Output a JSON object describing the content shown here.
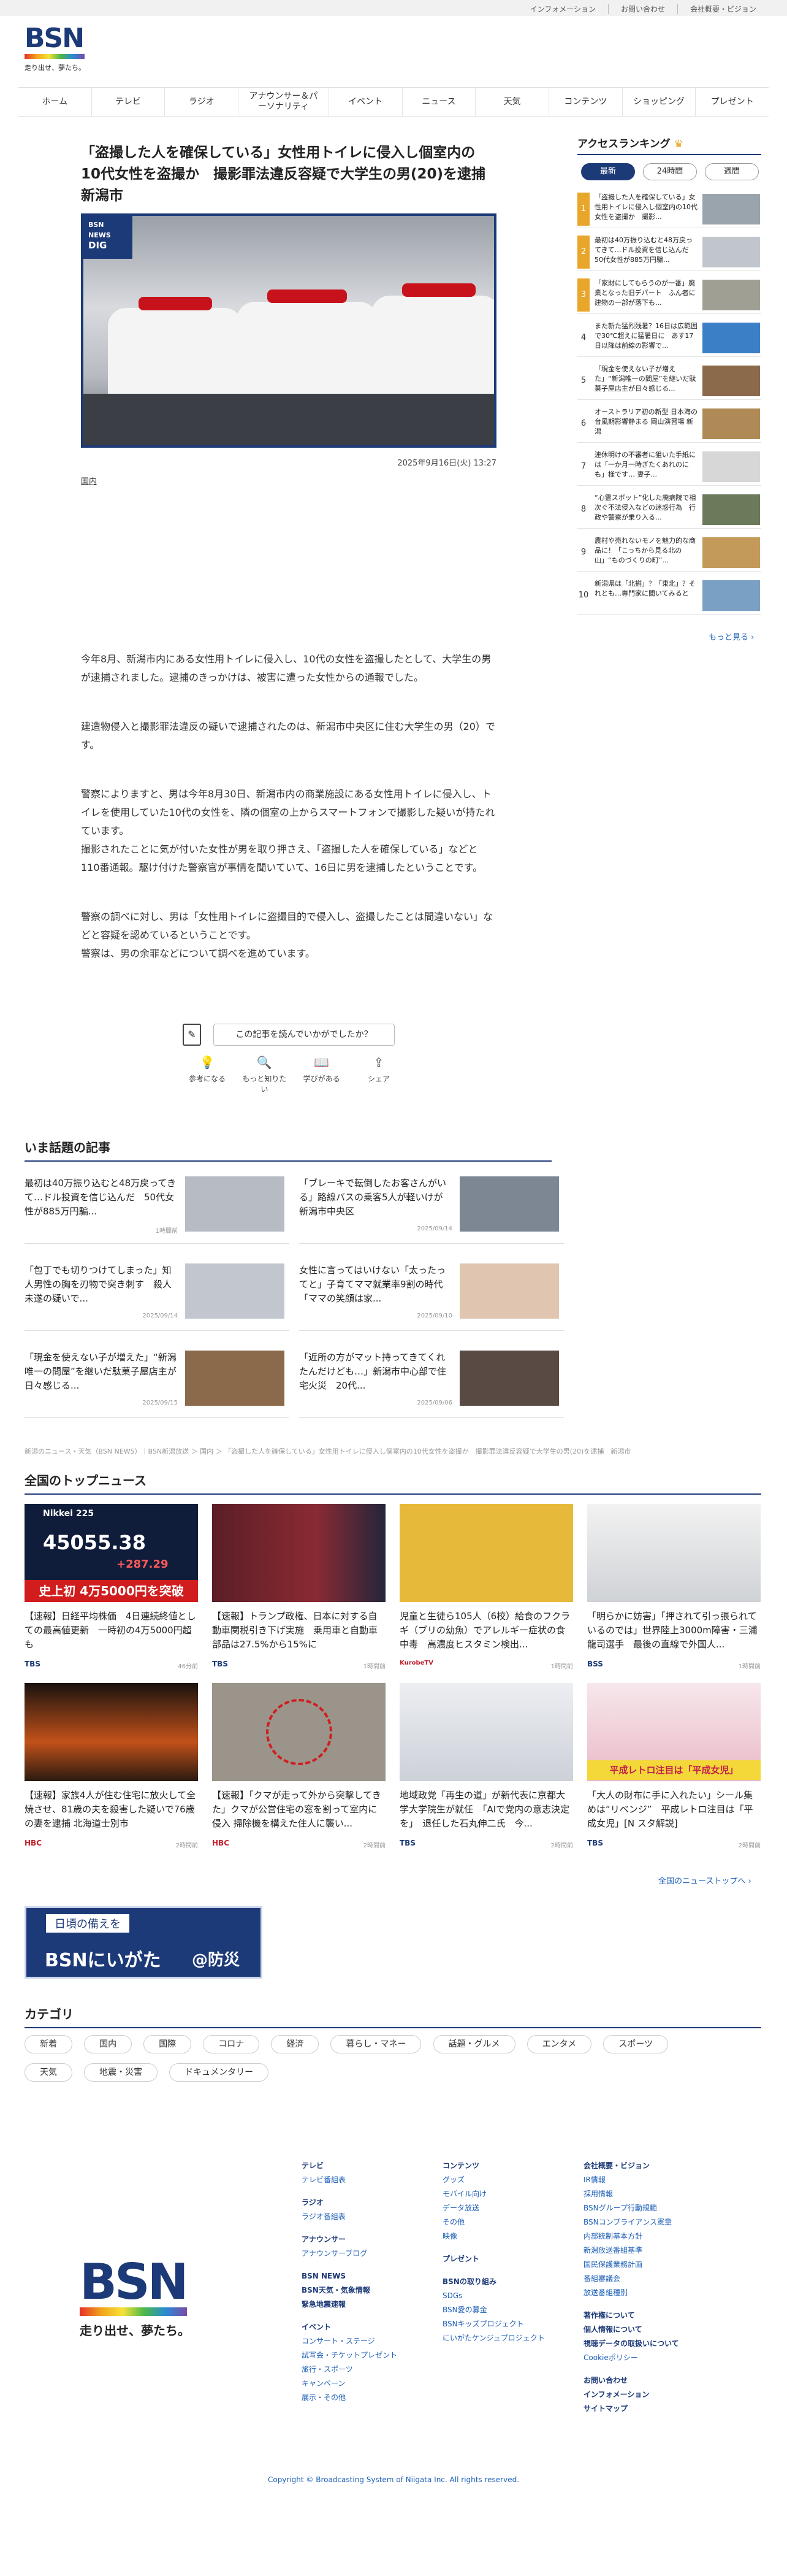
{
  "topbar": {
    "links": [
      "インフォメーション",
      "お問い合わせ",
      "会社概要・ビジョン"
    ]
  },
  "logo": {
    "text": "BSN",
    "tagline": "走り出せ、夢たち。"
  },
  "nav": [
    "ホーム",
    "テレビ",
    "ラジオ",
    "アナウンサー＆パーソナリティ",
    "イベント",
    "ニュース",
    "天気",
    "コンテンツ",
    "ショッピング",
    "プレゼント"
  ],
  "article": {
    "title": "「盗撮した人を確保している」女性用トイレに侵入し個室内の10代女性を盗撮か　撮影罪法違反容疑で大学生の男(20)を逮捕　新潟市",
    "badge_line1": "BSN",
    "badge_line2": "NEWS",
    "badge_line3": "DIG",
    "date": "2025年9月16日(火) 13:27",
    "category": "国内",
    "paragraphs": [
      "今年8月、新潟市内にある女性用トイレに侵入し、10代の女性を盗撮したとして、大学生の男が逮捕されました。逮捕のきっかけは、被害に遭った女性からの通報でした。",
      "建造物侵入と撮影罪法違反の疑いで逮捕されたのは、新潟市中央区に住む大学生の男（20）です。",
      "警察によりますと、男は今年8月30日、新潟市内の商業施設にある女性用トイレに侵入し、トイレを使用していた10代の女性を、隣の個室の上からスマートフォンで撮影した疑いが持たれています。",
      "撮影されたことに気が付いた女性が男を取り押さえ、「盗撮した人を確保している」などと110番通報。駆け付けた警察官が事情を聞いていて、16日に男を逮捕したということです。",
      "警察の調べに対し、男は「女性用トイレに盗撮目的で侵入し、盗撮したことは間違いない」などと容疑を認めているということです。",
      "警察は、男の余罪などについて調べを進めています。"
    ],
    "feedback_label": "この記事を読んでいかがでしたか？",
    "reactions": [
      "参考になる",
      "もっと知りたい",
      "学びがある",
      "シェア"
    ]
  },
  "ranking": {
    "title": "アクセスランキング",
    "tabs": [
      "最新",
      "24時間",
      "週間"
    ],
    "items": [
      {
        "n": "1",
        "t": "「盗撮した人を確保している」女性用トイレに侵入し個室内の10代女性を盗撮か　撮影..."
      },
      {
        "n": "2",
        "t": "最初は40万振り込むと48万戻ってきて…ドル投資を信じ込んだ　50代女性が885万円騙..."
      },
      {
        "n": "3",
        "t": "「家財にしてもらうのが一番」廃業となった旧デパート　ふん者に建物の一部が落下も..."
      },
      {
        "n": "4",
        "t": "また新た猛烈残暑？16日は広範囲で30℃超えに猛暑日に　あす17日以降は前線の影響で..."
      },
      {
        "n": "5",
        "t": "「現金を使えない子が増えた」“新潟唯一の問屋”を継いだ駄菓子屋店主が日々感じる..."
      },
      {
        "n": "6",
        "t": "オーストラリア初の新型 日本海の台風期影響静まる 岡山演習場 新潟"
      },
      {
        "n": "7",
        "t": "連休明けの不審者に狙いた手紙には「一か月一時ぎたくあれのにも」様です… 妻子..."
      },
      {
        "n": "8",
        "t": "“心霊スポット”化した廃病院で相次ぐ不法侵入などの迷惑行為　行政や警察が乗り入る..."
      },
      {
        "n": "9",
        "t": "農村や売れないモノを魅力的な商品に！「こっちから見る北の山」“ものづくりの町”..."
      },
      {
        "n": "10",
        "t": "新潟県は「北揃」？「東北」？それとも…専門家に聞いてみると"
      }
    ],
    "more": "もっと見る"
  },
  "trending": {
    "title": "いま話題の記事",
    "items": [
      {
        "t": "最初は40万振り込むと48万戻ってきて…ドル投資を信じ込んだ　50代女性が885万円騙...",
        "d": "1時間前"
      },
      {
        "t": "「ブレーキで転倒したお客さんがいる」路線バスの乗客5人が軽いけが　新潟市中央区",
        "d": "2025/09/14"
      },
      {
        "t": "「包丁でも切りつけてしまった」知人男性の胸を刃物で突き刺す　殺人未遂の疑いで...",
        "d": "2025/09/14"
      },
      {
        "t": "女性に言ってはいけない「太ったってと」子育てママ就業率9割の時代「ママの笑顔は家...",
        "d": "2025/09/10"
      },
      {
        "t": "「現金を使えない子が増えた」“新潟唯一の問屋”を継いだ駄菓子屋店主が日々感じる...",
        "d": "2025/09/15"
      },
      {
        "t": "「近所の方がマット持ってきてくれたんだけども…」新潟市中心部で住宅火災　20代...",
        "d": "2025/09/06"
      }
    ]
  },
  "breadcrumb": "新潟のニュース・天気（BSN NEWS）｜BSN新潟放送 ＞ 国内 ＞ 「盗撮した人を確保している」女性用トイレに侵入し個室内の10代女性を盗撮か　撮影罪法違反容疑で大学生の男(20)を逮捕　新潟市",
  "national": {
    "title": "全国のトップニュース",
    "ticker_label": "Nikkei 225",
    "ticker_value": "45055.38",
    "ticker_change": "+287.29",
    "ticker_banner": "史上初 4万5000円を突破",
    "items": [
      {
        "t": "【速報】日経平均株価　4日連続終値としての最高値更新　一時初の4万5000円超も",
        "src": "TBS",
        "d": "46分前"
      },
      {
        "t": "【速報】トランプ政権、日本に対する自動車関税引き下げ実施　乗用車と自動車部品は27.5%から15%に",
        "src": "TBS",
        "d": "1時間前"
      },
      {
        "t": "児童と生徒ら105人（6校）給食のフクラギ（ブリの幼魚）でアレルギー症状の食中毒　高濃度ヒスタミン検出...",
        "src": "KurobeTV",
        "d": "1時間前"
      },
      {
        "t": "「明らかに妨害」「押されて引っ張られているのでは」世界陸上3000m障害・三浦龍司選手　最後の直線で外国人...",
        "src": "BSS",
        "d": "1時間前"
      },
      {
        "t": "【速報】家族4人が住む住宅に放火して全焼させ、81歳の夫を殺害した疑いで76歳の妻を逮捕 北海道士別市",
        "src": "HBC",
        "d": "2時間前"
      },
      {
        "t": "【速報】「クマが走って外から突撃してきた」クマが公営住宅の窓を割って室内に侵入 掃除機を構えた住人に襲い...",
        "src": "HBC",
        "d": "2時間前"
      },
      {
        "t": "地域政党「再生の道」が新代表に京都大学大学院生が就任　「AIで党内の意志決定を」　退任した石丸伸二氏　今...",
        "src": "TBS",
        "d": "2時間前"
      },
      {
        "t": "「大人の財布に手に入れたい」シール集めは“リベンジ”　平成レトロ注目は「平成女児」[N スタ解説]",
        "src": "TBS",
        "d": "2時間前"
      }
    ],
    "more": "全国のニューストップへ",
    "panel_caption_main": "平成レトロ注目は「平成女児」"
  },
  "bousai": {
    "line1": "日頃の備えを",
    "line2": "BSNにいがた",
    "line3": "@防災"
  },
  "categories": {
    "title": "カテゴリ",
    "items": [
      "新着",
      "国内",
      "国際",
      "コロナ",
      "経済",
      "暮らし・マネー",
      "話題・グルメ",
      "エンタメ",
      "スポーツ",
      "天気",
      "地震・災害",
      "ドキュメンタリー"
    ]
  },
  "footer": {
    "col1": [
      {
        "h": "テレビ"
      },
      {
        "l": "テレビ番組表"
      },
      {
        "s": ""
      },
      {
        "h": "ラジオ"
      },
      {
        "l": "ラジオ番組表"
      },
      {
        "s": ""
      },
      {
        "h": "アナウンサー"
      },
      {
        "l": "アナウンサーブログ"
      },
      {
        "s": ""
      },
      {
        "h": "BSN NEWS"
      },
      {
        "h": "BSN天気・気象情報"
      },
      {
        "h": "緊急地震速報"
      },
      {
        "s": ""
      },
      {
        "h": "イベント"
      },
      {
        "l": "コンサート・ステージ"
      },
      {
        "l": "試写会・チケットプレゼント"
      },
      {
        "l": "旅行・スポーツ"
      },
      {
        "l": "キャンペーン"
      },
      {
        "l": "展示・その他"
      }
    ],
    "col2": [
      {
        "h": "コンテンツ"
      },
      {
        "l": "グッズ"
      },
      {
        "l": "モバイル向け"
      },
      {
        "l": "データ放送"
      },
      {
        "l": "その他"
      },
      {
        "l": "映像"
      },
      {
        "s": ""
      },
      {
        "h": "プレゼント"
      },
      {
        "s": ""
      },
      {
        "h": "BSNの取り組み"
      },
      {
        "l": "SDGs"
      },
      {
        "l": "BSN愛の募金"
      },
      {
        "l": "BSNキッズプロジェクト"
      },
      {
        "l": "にいがたケンジュプロジェクト"
      }
    ],
    "col3": [
      {
        "h": "会社概要・ビジョン"
      },
      {
        "l": "IR情報"
      },
      {
        "l": "採用情報"
      },
      {
        "l": "BSNグループ行動規範"
      },
      {
        "l": "BSNコンプライアンス憲章"
      },
      {
        "l": "内部統制基本方針"
      },
      {
        "l": "新潟放送番組基準"
      },
      {
        "l": "国民保護業務計画"
      },
      {
        "l": "番組審議会"
      },
      {
        "l": "放送番組種別"
      },
      {
        "s": ""
      },
      {
        "h": "著作権について"
      },
      {
        "h": "個人情報について"
      },
      {
        "h": "視聴データの取扱いについて"
      },
      {
        "l": "Cookieポリシー"
      },
      {
        "s": ""
      },
      {
        "h": "お問い合わせ"
      },
      {
        "h": "インフォメーション"
      },
      {
        "h": "サイトマップ"
      }
    ],
    "copyright": "Copyright © Broadcasting System of Niigata Inc. All rights reserved."
  }
}
